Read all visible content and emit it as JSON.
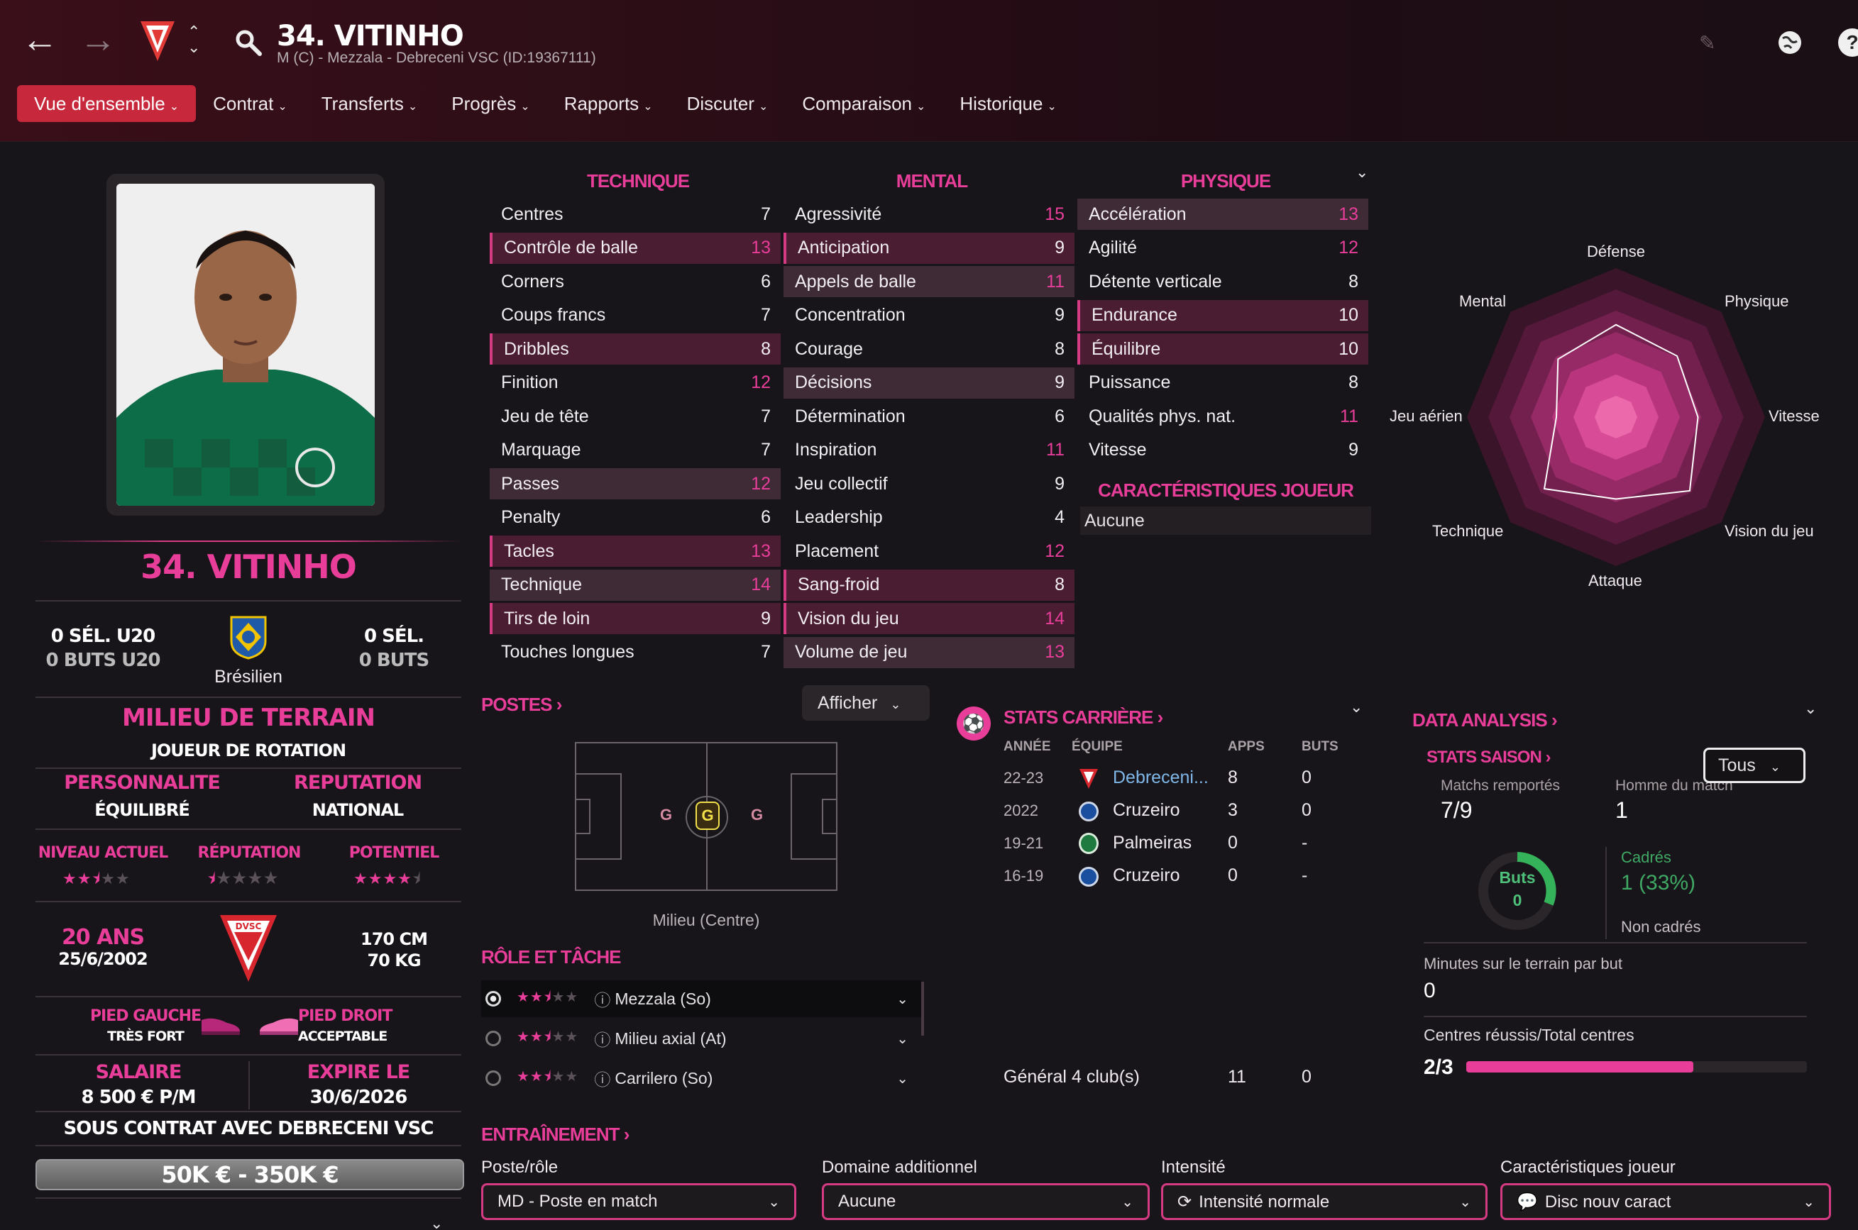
{
  "header": {
    "title": "34. VITINHO",
    "subtitle": "M (C) - Mezzala - Debreceni VSC (ID:19367111)",
    "club_badge": "DVSC"
  },
  "tabs": [
    {
      "label": "Vue d'ensemble"
    },
    {
      "label": "Contrat"
    },
    {
      "label": "Transferts"
    },
    {
      "label": "Progrès"
    },
    {
      "label": "Rapports"
    },
    {
      "label": "Discuter"
    },
    {
      "label": "Comparaison"
    },
    {
      "label": "Historique"
    }
  ],
  "profile": {
    "name": "34. VITINHO",
    "u20_caps": "0 SÉL. U20",
    "u20_goals": "0 BUTS U20",
    "caps": "0 SÉL.",
    "goals": "0 BUTS",
    "nationality": "Brésilien",
    "position": "MILIEU DE TERRAIN",
    "squad_status": "JOUEUR DE ROTATION",
    "personality_label": "PERSONNALITE",
    "personality": "ÉQUILIBRÉ",
    "reputation_label": "REPUTATION",
    "reputation": "NATIONAL",
    "current_level_label": "NIVEAU ACTUEL",
    "current_level_stars": 2.5,
    "reputation_stars_label": "RÉPUTATION",
    "reputation_stars": 0.5,
    "potential_label": "POTENTIEL",
    "potential_stars": 4.5,
    "age": "20 ANS",
    "dob": "25/6/2002",
    "height": "170 CM",
    "weight": "70 KG",
    "left_foot_label": "PIED GAUCHE",
    "left_foot": "TRÈS FORT",
    "right_foot_label": "PIED DROIT",
    "right_foot": "ACCEPTABLE",
    "salary_label": "SALAIRE",
    "salary": "8 500 € P/M",
    "expires_label": "EXPIRE LE",
    "expires": "30/6/2026",
    "contract": "SOUS CONTRAT AVEC DEBRECENI VSC",
    "value": "50K € - 350K €"
  },
  "attributes": {
    "technique_title": "TECHNIQUE",
    "mental_title": "MENTAL",
    "physique_title": "PHYSIQUE",
    "technique": [
      {
        "name": "Centres",
        "value": "7"
      },
      {
        "name": "Contrôle de balle",
        "value": "13"
      },
      {
        "name": "Corners",
        "value": "6"
      },
      {
        "name": "Coups francs",
        "value": "7"
      },
      {
        "name": "Dribbles",
        "value": "8"
      },
      {
        "name": "Finition",
        "value": "12"
      },
      {
        "name": "Jeu de tête",
        "value": "7"
      },
      {
        "name": "Marquage",
        "value": "7"
      },
      {
        "name": "Passes",
        "value": "12"
      },
      {
        "name": "Penalty",
        "value": "6"
      },
      {
        "name": "Tacles",
        "value": "13"
      },
      {
        "name": "Technique",
        "value": "14"
      },
      {
        "name": "Tirs de loin",
        "value": "9"
      },
      {
        "name": "Touches longues",
        "value": "7"
      }
    ],
    "mental": [
      {
        "name": "Agressivité",
        "value": "15"
      },
      {
        "name": "Anticipation",
        "value": "9"
      },
      {
        "name": "Appels de balle",
        "value": "11"
      },
      {
        "name": "Concentration",
        "value": "9"
      },
      {
        "name": "Courage",
        "value": "8"
      },
      {
        "name": "Décisions",
        "value": "9"
      },
      {
        "name": "Détermination",
        "value": "6"
      },
      {
        "name": "Inspiration",
        "value": "11"
      },
      {
        "name": "Jeu collectif",
        "value": "9"
      },
      {
        "name": "Leadership",
        "value": "4"
      },
      {
        "name": "Placement",
        "value": "12"
      },
      {
        "name": "Sang-froid",
        "value": "8"
      },
      {
        "name": "Vision du jeu",
        "value": "14"
      },
      {
        "name": "Volume de jeu",
        "value": "13"
      }
    ],
    "physique": [
      {
        "name": "Accélération",
        "value": "13"
      },
      {
        "name": "Agilité",
        "value": "12"
      },
      {
        "name": "Détente verticale",
        "value": "8"
      },
      {
        "name": "Endurance",
        "value": "10"
      },
      {
        "name": "Équilibre",
        "value": "10"
      },
      {
        "name": "Puissance",
        "value": "8"
      },
      {
        "name": "Qualités phys. nat.",
        "value": "11"
      },
      {
        "name": "Vitesse",
        "value": "9"
      }
    ],
    "traits_title": "CARACTÉRISTIQUES JOUEUR",
    "traits_value": "Aucune"
  },
  "radar": {
    "labels": [
      "Défense",
      "Physique",
      "Vitesse",
      "Vision du jeu",
      "Attaque",
      "Technique",
      "Jeu aérien",
      "Mental"
    ],
    "values": [
      0.62,
      0.58,
      0.55,
      0.7,
      0.55,
      0.68,
      0.4,
      0.55
    ]
  },
  "positions": {
    "title": "POSTES",
    "show_button": "Afficher",
    "pitch_caption": "Milieu (Centre)",
    "role_title": "RÔLE ET TÂCHE",
    "roles": [
      {
        "label": "Mezzala (So)",
        "stars": 2.5
      },
      {
        "label": "Milieu axial (At)",
        "stars": 2.5
      },
      {
        "label": "Carrilero (So)",
        "stars": 2.5
      }
    ]
  },
  "career": {
    "title": "STATS CARRIÈRE",
    "headers": [
      "ANNÉE",
      "ÉQUIPE",
      "APPS",
      "BUTS"
    ],
    "rows": [
      {
        "year": "22-23",
        "team": "Debreceni...",
        "apps": "8",
        "goals": "0"
      },
      {
        "year": "2022",
        "team": "Cruzeiro",
        "apps": "3",
        "goals": "0"
      },
      {
        "year": "19-21",
        "team": "Palmeiras",
        "apps": "0",
        "goals": "-"
      },
      {
        "year": "16-19",
        "team": "Cruzeiro",
        "apps": "0",
        "goals": "-"
      }
    ],
    "total_label": "Général",
    "total_clubs": "4 club(s)",
    "total_apps": "11",
    "total_goals": "0"
  },
  "analysis": {
    "title": "DATA ANALYSIS",
    "season_title": "STATS SAISON",
    "filter": "Tous",
    "wins_label": "Matchs remportés",
    "wins": "7/9",
    "motm_label": "Homme du match",
    "motm": "1",
    "goals_label": "Buts",
    "goals": "0",
    "on_target_label": "Cadrés",
    "on_target": "1 (33%)",
    "off_target_label": "Non cadrés",
    "minutes_label": "Minutes sur le terrain par but",
    "minutes": "0",
    "crosses_label": "Centres réussis/Total centres",
    "crosses": "2/3",
    "crosses_ratio": 0.667
  },
  "training": {
    "title": "ENTRAÎNEMENT",
    "role_label": "Poste/rôle",
    "role_value": "MD - Poste en match",
    "extra_label": "Domaine additionnel",
    "extra_value": "Aucune",
    "intensity_label": "Intensité",
    "intensity_value": "Intensité normale",
    "traits_label": "Caractéristiques joueur",
    "traits_value": "Disc nouv caract"
  },
  "colors": {
    "accent": "#e83e9a",
    "active_tab": "#c8283c",
    "highlight_row": "#4a1d33",
    "green": "#35b35a"
  }
}
